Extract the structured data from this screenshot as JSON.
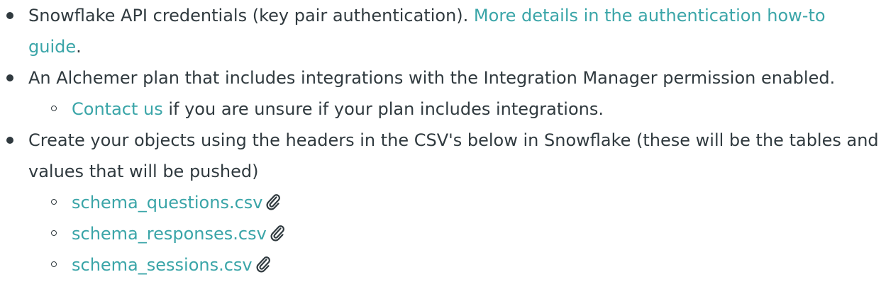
{
  "list": {
    "item1": {
      "text": "Snowflake API credentials (key pair authentication). ",
      "link": "More details in the authentication how-to guide",
      "suffix": "."
    },
    "item2": {
      "text": "An Alchemer plan that includes integrations with the Integration Manager permission enabled.",
      "sub": {
        "link": "Contact us",
        "text": " if you are unsure if your plan includes integrations."
      }
    },
    "item3": {
      "text": "Create your objects using the headers in the CSV's below in Snowflake (these will be the tables and values that will be pushed)",
      "files": [
        {
          "name": "schema_questions.csv",
          "icon": "paperclip-icon"
        },
        {
          "name": "schema_responses.csv",
          "icon": "paperclip-icon"
        },
        {
          "name": "schema_sessions.csv",
          "icon": "paperclip-icon"
        }
      ]
    }
  },
  "colors": {
    "text": "#303a3f",
    "link": "#3aa5a8"
  }
}
